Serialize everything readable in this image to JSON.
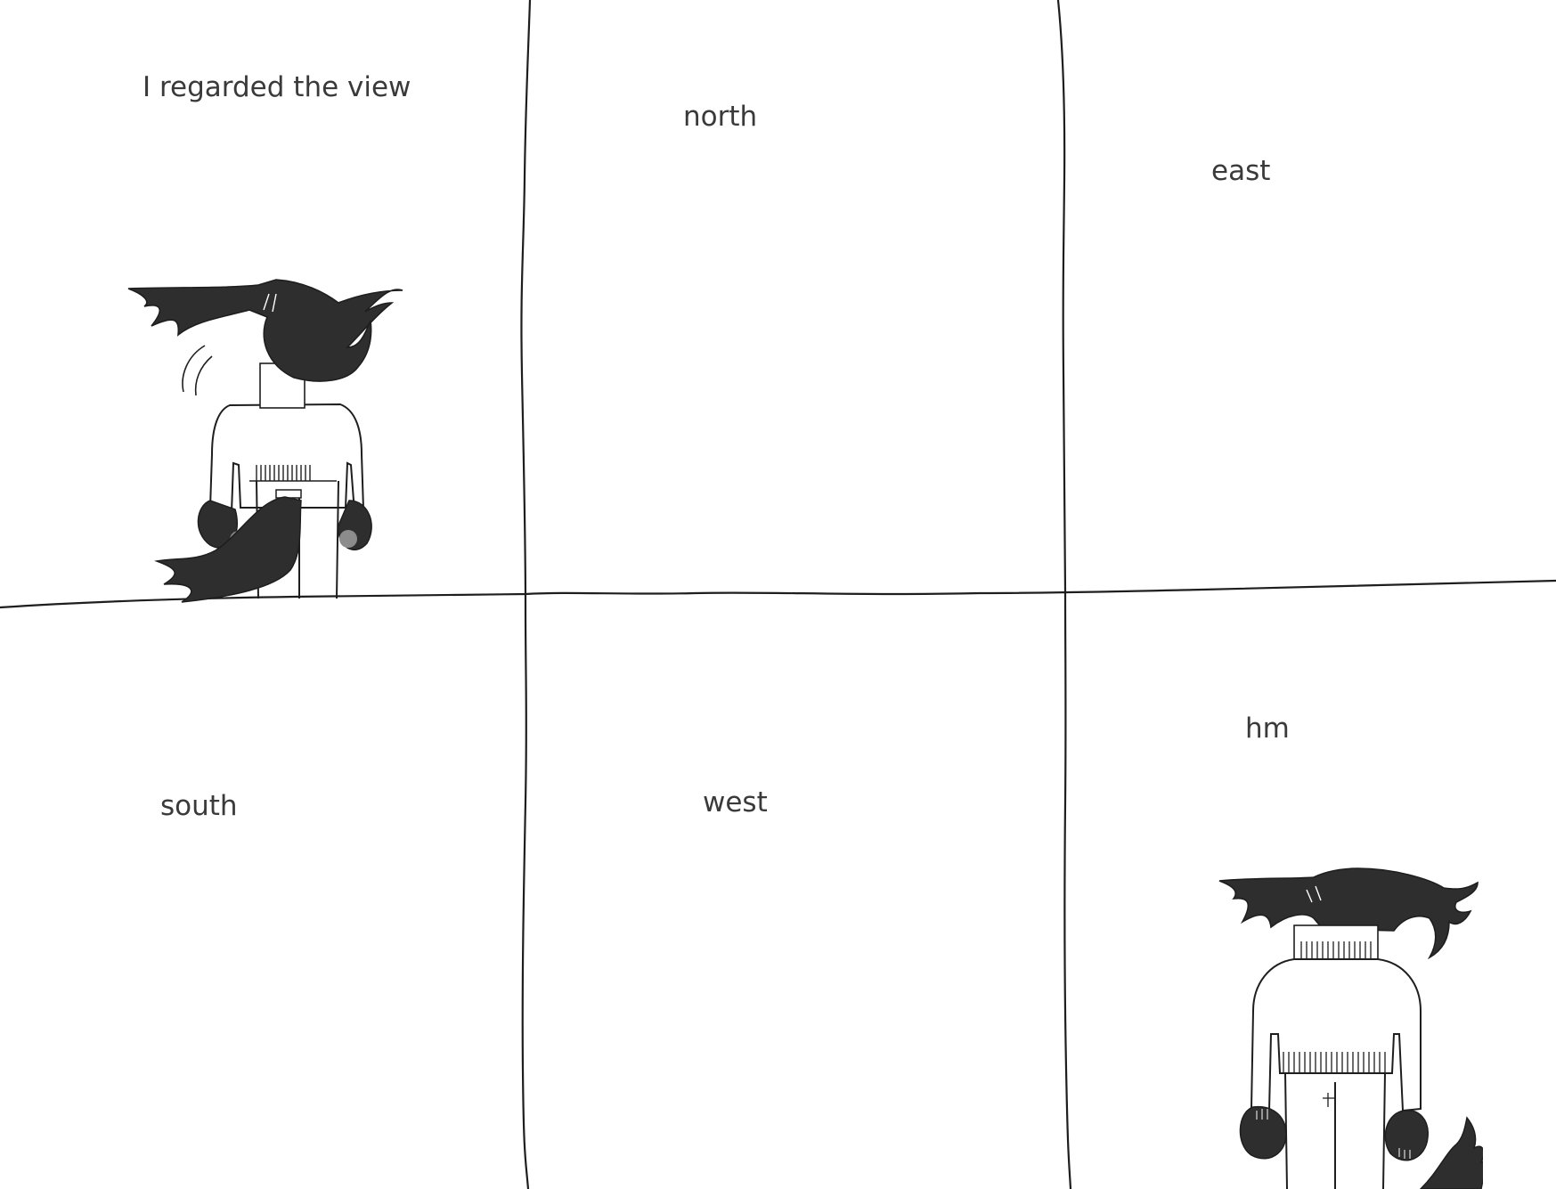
{
  "panels": [
    {
      "caption": "I regarded the view"
    },
    {
      "caption": "north"
    },
    {
      "caption": "east"
    },
    {
      "caption": "south"
    },
    {
      "caption": "west"
    },
    {
      "caption": "hm"
    }
  ],
  "colors": {
    "background": "#ffffff",
    "ink": "#1e1e1e",
    "hair": "#2e2e2e",
    "text": "#3a3a3a",
    "accent_grey": "#8c8c8c"
  }
}
